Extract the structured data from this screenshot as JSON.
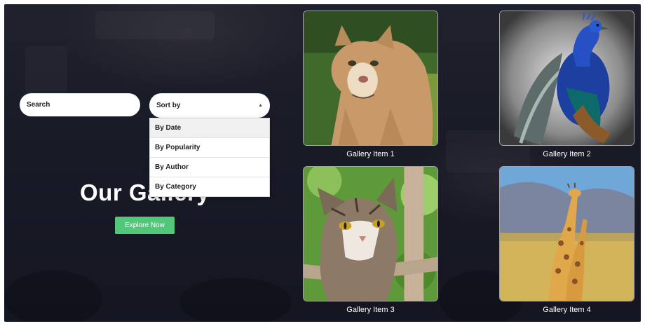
{
  "search": {
    "placeholder": "Search"
  },
  "sort": {
    "label": "Sort by",
    "options": [
      {
        "label": "By Date",
        "active": true
      },
      {
        "label": "By Popularity",
        "active": false
      },
      {
        "label": "By Author",
        "active": false
      },
      {
        "label": "By Category",
        "active": false
      }
    ]
  },
  "hero": {
    "title": "Our Gallery",
    "button_label": "Explore Now"
  },
  "colors": {
    "accent": "#52c77a"
  },
  "gallery": [
    {
      "caption": "Gallery Item 1",
      "image": "cougar"
    },
    {
      "caption": "Gallery Item 2",
      "image": "peacock"
    },
    {
      "caption": "Gallery Item 3",
      "image": "cat"
    },
    {
      "caption": "Gallery Item 4",
      "image": "giraffes"
    }
  ]
}
